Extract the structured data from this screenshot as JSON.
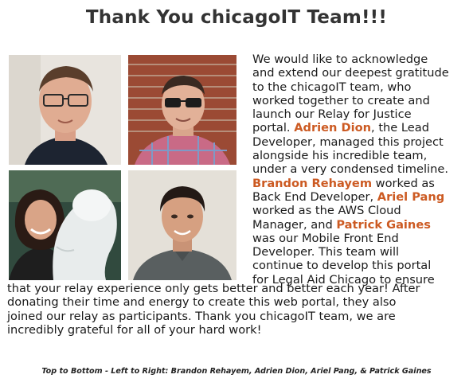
{
  "title": "Thank You chicagoIT Team!!!",
  "body": {
    "s1": "We would like to acknowledge",
    "s2": "and extend our deepest gratitude",
    "s3": "to the chicagoIT team, who",
    "s4": "worked together to create and",
    "s5": "launch our Relay for Justice",
    "s6a": "portal. ",
    "n1": "Adrien Dion",
    "s6b": ", the Lead",
    "s7": "Developer, managed this project",
    "s8": "alongside his incredible team,",
    "s9": "under a very condensed timeline.",
    "n2": "Brandon Rehayem",
    "s10b": " worked as",
    "s11a": "Back End Developer, ",
    "n3": "Ariel Pang",
    "s12": "worked as the AWS Cloud",
    "s13a": "Manager, and ",
    "n4": "Patrick Gaines",
    "s14": "was our Mobile Front End",
    "s15": "Developer. This team will",
    "s16": "continue to develop this portal",
    "s17": "for Legal Aid Chicago to ensure",
    "f1": "that your relay experience only gets better and better each year! After",
    "f2": "donating their time and energy to create this web portal, they also",
    "f3": "joined our relay as participants. Thank you chicagoIT team, we are",
    "f4": "incredibly grateful for all of your hard work!"
  },
  "caption": "Top to Bottom - Left to Right: Brandon Rehayem, Adrien Dion, Ariel Pang, & Patrick Gaines"
}
